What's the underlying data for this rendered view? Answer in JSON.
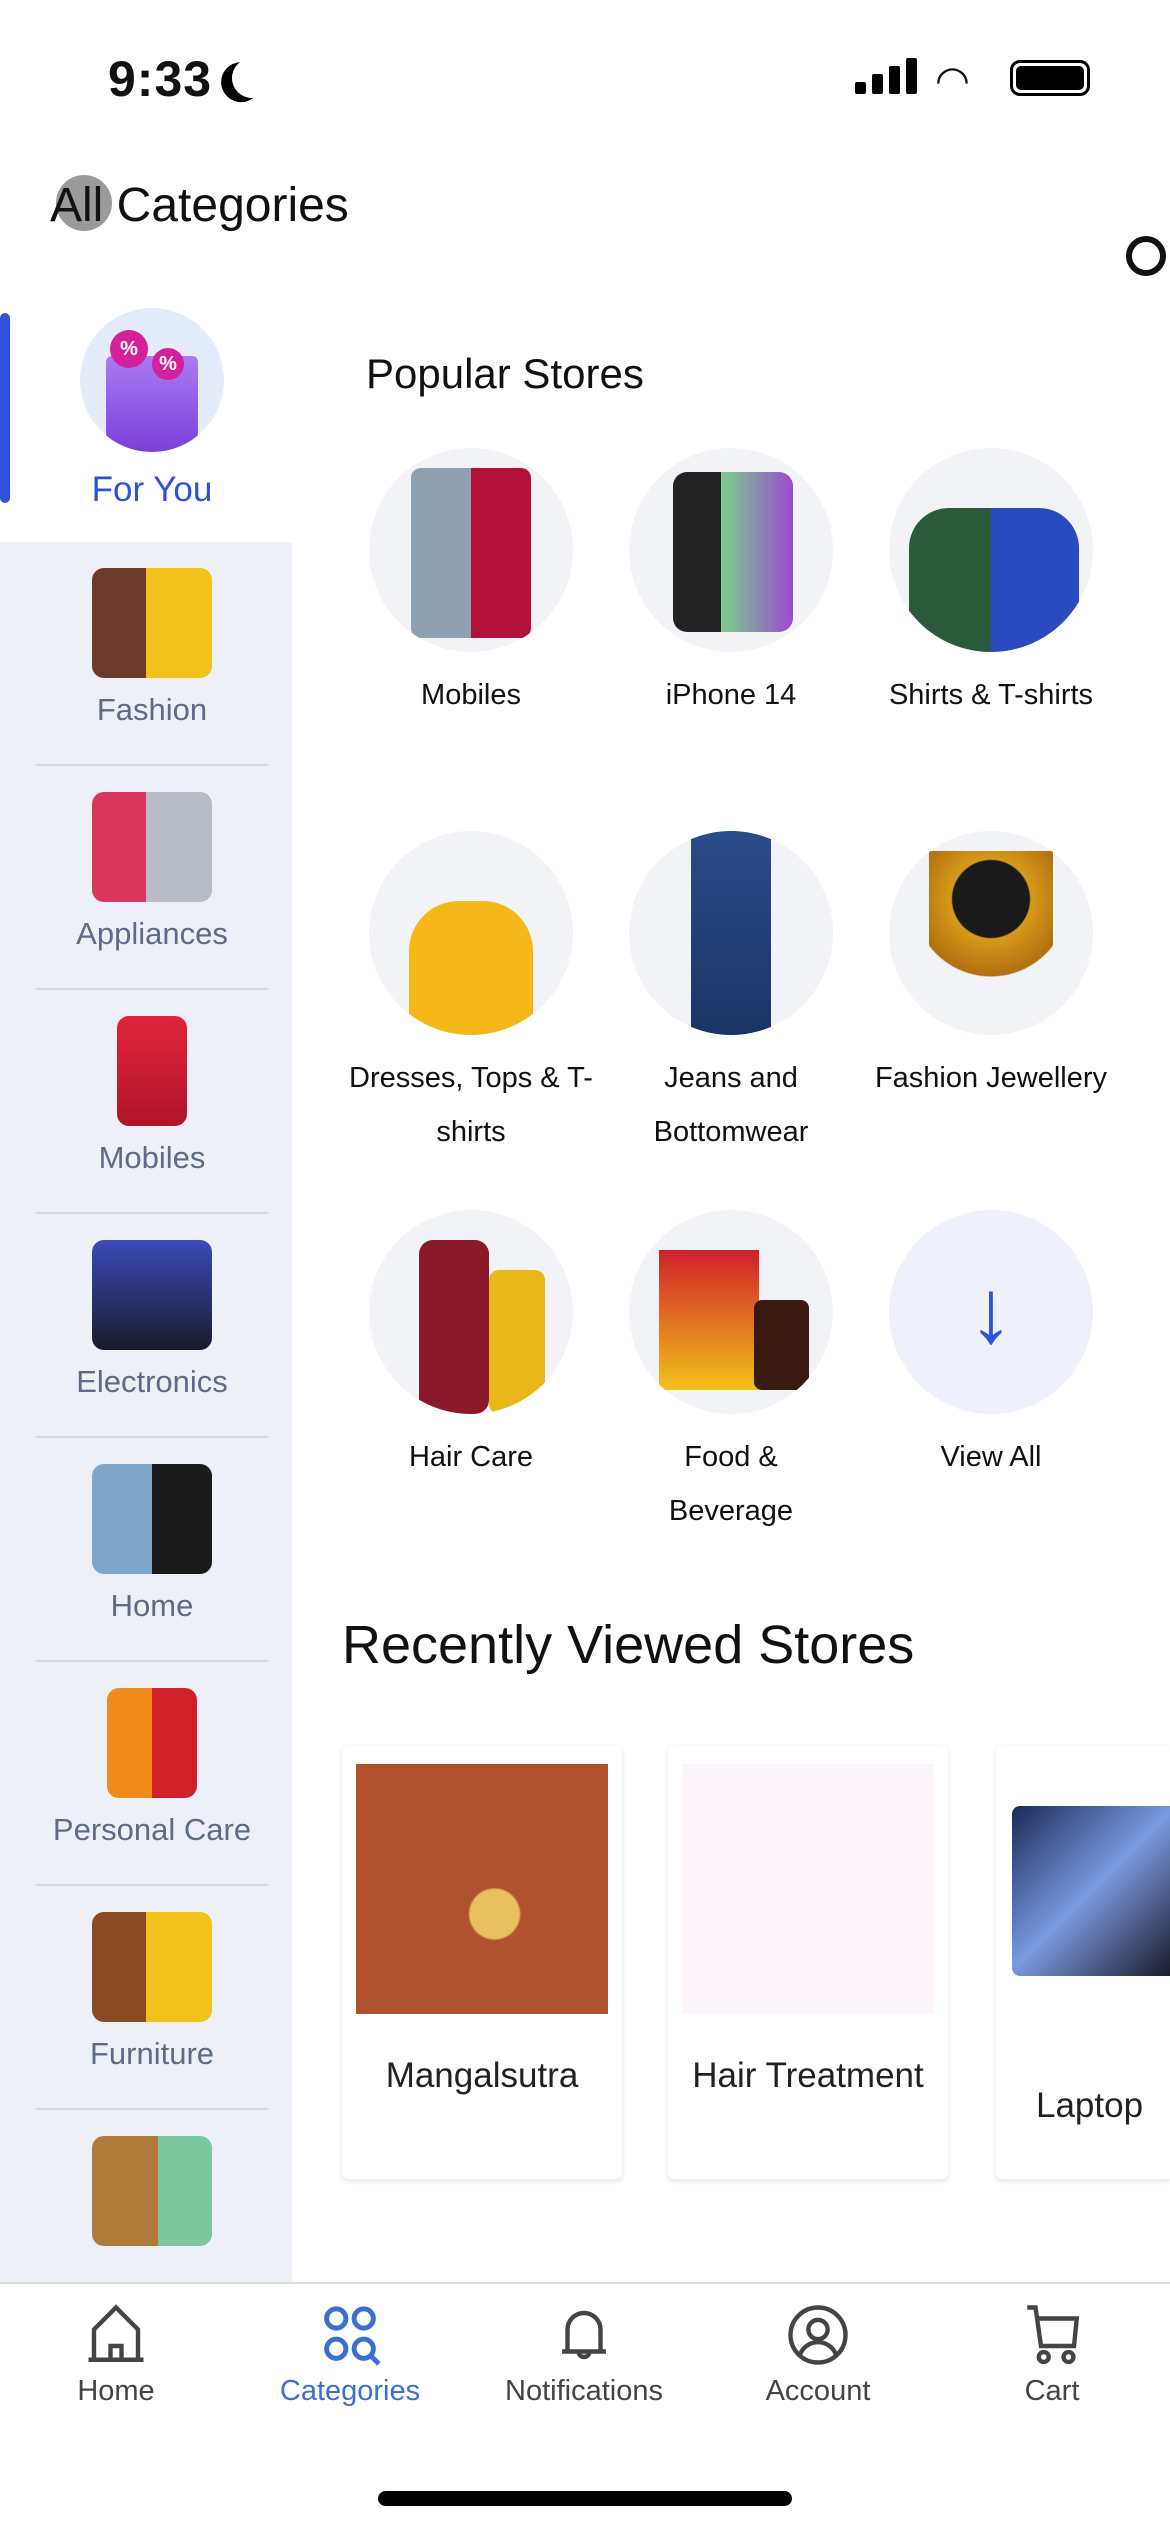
{
  "status_bar": {
    "time": "9:33"
  },
  "header": {
    "title_prefix": "All",
    "title_rest": " Categories"
  },
  "sidebar": {
    "active": {
      "label": "For You"
    },
    "items": [
      {
        "label": "Fashion"
      },
      {
        "label": "Appliances"
      },
      {
        "label": "Mobiles"
      },
      {
        "label": "Electronics"
      },
      {
        "label": "Home"
      },
      {
        "label": "Personal Care"
      },
      {
        "label": "Furniture"
      },
      {
        "label": ""
      }
    ]
  },
  "popular": {
    "title": "Popular Stores",
    "stores": [
      {
        "label": "Mobiles"
      },
      {
        "label": "iPhone 14"
      },
      {
        "label": "Shirts & T-shirts"
      },
      {
        "label": "Dresses, Tops & T-shirts"
      },
      {
        "label": "Jeans and Bottomwear"
      },
      {
        "label": "Fashion Jewellery"
      },
      {
        "label": "Hair Care"
      },
      {
        "label": "Food & Beverage"
      },
      {
        "label": "View All"
      }
    ]
  },
  "recent": {
    "title": "Recently Viewed Stores",
    "cards": [
      {
        "label": "Mangalsutra"
      },
      {
        "label": "Hair Treatment"
      },
      {
        "label": "Laptop"
      }
    ]
  },
  "nav": {
    "items": [
      {
        "label": "Home"
      },
      {
        "label": "Categories"
      },
      {
        "label": "Notifications"
      },
      {
        "label": "Account"
      },
      {
        "label": "Cart"
      }
    ],
    "active": "Categories"
  },
  "colors": {
    "accent": "#2f52d8",
    "sidebar_bg": "#eef0f8",
    "nav_active": "#3b6fd4"
  }
}
